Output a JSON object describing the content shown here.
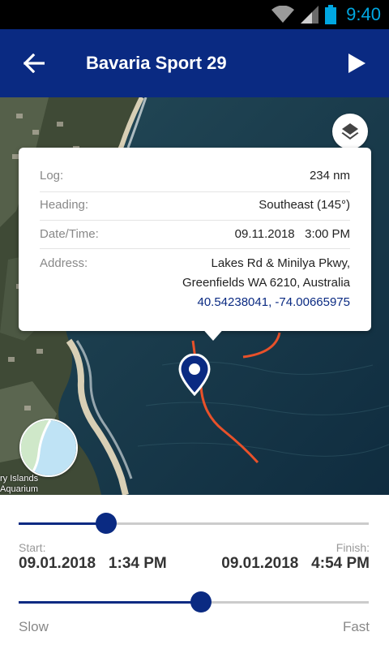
{
  "status_bar": {
    "time": "9:40"
  },
  "app_bar": {
    "title": "Bavaria Sport 29"
  },
  "popup": {
    "log_label": "Log:",
    "log_value": "234 nm",
    "heading_label": "Heading:",
    "heading_value": "Southeast (145°)",
    "datetime_label": "Date/Time:",
    "datetime_value": "09.11.2018   3:00 PM",
    "address_label": "Address:",
    "address_line1": "Lakes Rd & Minilya Pkwy,",
    "address_line2": "Greenfields WA 6210, Australia",
    "coordinates": "40.54238041, -74.00665975"
  },
  "map": {
    "poi_label_line1": "ry Islands",
    "poi_label_line2": "Aquarium"
  },
  "timeline": {
    "start_label": "Start:",
    "finish_label": "Finish:",
    "start_value": "09.01.2018   1:34 PM",
    "finish_value": "09.01.2018   4:54 PM",
    "position_fraction": 0.25
  },
  "speed": {
    "slow_label": "Slow",
    "fast_label": "Fast",
    "level_fraction": 0.52
  },
  "colors": {
    "app_bar": "#0a2a82",
    "track_line": "#e8512a",
    "status_accent": "#00a7e1"
  }
}
